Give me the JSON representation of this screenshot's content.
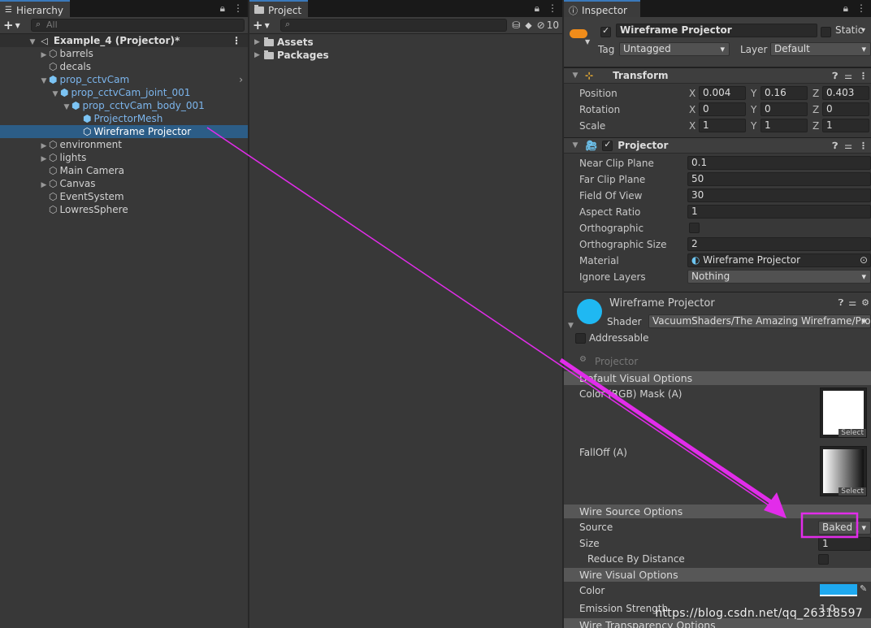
{
  "hierarchy": {
    "tab": "Hierarchy",
    "search_placeholder": "All",
    "scene": "Example_4 (Projector)*",
    "items": [
      {
        "label": "barrels",
        "indent": 1,
        "arrow": "▶",
        "prefab": false,
        "sel": false
      },
      {
        "label": "decals",
        "indent": 1,
        "arrow": "",
        "prefab": false,
        "sel": false
      },
      {
        "label": "prop_cctvCam",
        "indent": 1,
        "arrow": "▼",
        "prefab": true,
        "sel": false,
        "chev": true
      },
      {
        "label": "prop_cctvCam_joint_001",
        "indent": 2,
        "arrow": "▼",
        "prefab": true,
        "sel": false
      },
      {
        "label": "prop_cctvCam_body_001",
        "indent": 3,
        "arrow": "▼",
        "prefab": true,
        "sel": false
      },
      {
        "label": "ProjectorMesh",
        "indent": 4,
        "arrow": "",
        "prefab": true,
        "sel": false
      },
      {
        "label": "Wireframe Projector",
        "indent": 4,
        "arrow": "",
        "prefab": false,
        "sel": true
      },
      {
        "label": "environment",
        "indent": 1,
        "arrow": "▶",
        "prefab": false,
        "sel": false
      },
      {
        "label": "lights",
        "indent": 1,
        "arrow": "▶",
        "prefab": false,
        "sel": false
      },
      {
        "label": "Main Camera",
        "indent": 1,
        "arrow": "",
        "prefab": false,
        "sel": false
      },
      {
        "label": "Canvas",
        "indent": 1,
        "arrow": "▶",
        "prefab": false,
        "sel": false
      },
      {
        "label": "EventSystem",
        "indent": 1,
        "arrow": "",
        "prefab": false,
        "sel": false
      },
      {
        "label": "LowresSphere",
        "indent": 1,
        "arrow": "",
        "prefab": false,
        "sel": false
      }
    ]
  },
  "project": {
    "tab": "Project",
    "hidden_count": "10",
    "items": [
      "Assets",
      "Packages"
    ]
  },
  "inspector": {
    "tab": "Inspector",
    "object_name": "Wireframe Projector",
    "static_label": "Static",
    "tag_label": "Tag",
    "tag_value": "Untagged",
    "layer_label": "Layer",
    "layer_value": "Default",
    "transform": {
      "title": "Transform",
      "position_label": "Position",
      "position": [
        "0.004",
        "0.16",
        "0.403"
      ],
      "rotation_label": "Rotation",
      "rotation": [
        "0",
        "0",
        "0"
      ],
      "scale_label": "Scale",
      "scale": [
        "1",
        "1",
        "1"
      ],
      "axes": [
        "X",
        "Y",
        "Z"
      ]
    },
    "projector": {
      "title": "Projector",
      "props": [
        {
          "label": "Near Clip Plane",
          "value": "0.1",
          "kind": "field"
        },
        {
          "label": "Far Clip Plane",
          "value": "50",
          "kind": "field"
        },
        {
          "label": "Field Of View",
          "value": "30",
          "kind": "field"
        },
        {
          "label": "Aspect Ratio",
          "value": "1",
          "kind": "field"
        },
        {
          "label": "Orthographic",
          "value": "",
          "kind": "check"
        },
        {
          "label": "Orthographic Size",
          "value": "2",
          "kind": "field"
        },
        {
          "label": "Material",
          "value": "Wireframe Projector",
          "kind": "object"
        },
        {
          "label": "Ignore Layers",
          "value": "Nothing",
          "kind": "dropdown"
        }
      ]
    },
    "material": {
      "name": "Wireframe Projector",
      "shader_label": "Shader",
      "shader": "VacuumShaders/The Amazing Wireframe/Proj",
      "addressable": "Addressable",
      "section": "Projector",
      "default_visual": "Default Visual Options",
      "color_mask": "Color (RGB) Mask (A)",
      "falloff": "FallOff (A)",
      "select": "Select",
      "wire_source": "Wire Source Options",
      "source_label": "Source",
      "source_value": "Baked (",
      "size_label": "Size",
      "size_value": "1",
      "reduce_label": "Reduce By Distance",
      "wire_visual": "Wire Visual Options",
      "color_label": "Color",
      "emission_label": "Emission Strength",
      "emission_value": "1.0",
      "wire_transparency": "Wire Transparency Options"
    }
  },
  "colors": {
    "annotation": "#e22cea",
    "selection": "#2c5d87",
    "wire_color": "#1ea9f0",
    "material_ball": "#1fb8f2",
    "prefab_text": "#7cb5ec"
  },
  "watermark": "https://blog.csdn.net/qq_26318597"
}
